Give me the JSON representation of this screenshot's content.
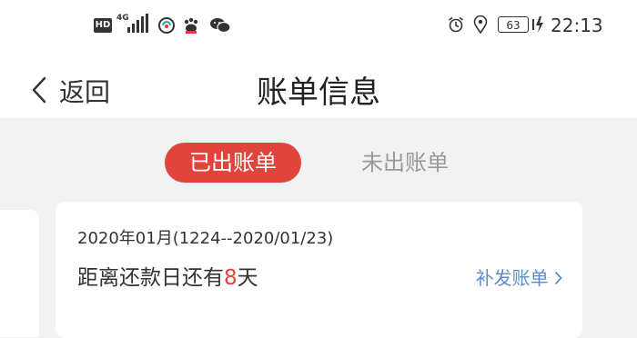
{
  "status_bar": {
    "hd": "HD",
    "network": "4G",
    "battery": "63",
    "time": "22:13"
  },
  "nav": {
    "back_label": "返回",
    "title": "账单信息"
  },
  "tabs": [
    {
      "label": "已出账单",
      "active": true
    },
    {
      "label": "未出账单",
      "active": false
    }
  ],
  "bill": {
    "period": "2020年01月(1224--2020/01/23)",
    "due_prefix": "距离还款日还有",
    "due_days": "8",
    "due_suffix": "天",
    "reissue_label": "补发账单"
  },
  "colors": {
    "accent": "#e0443a",
    "link": "#5b8ec7"
  }
}
